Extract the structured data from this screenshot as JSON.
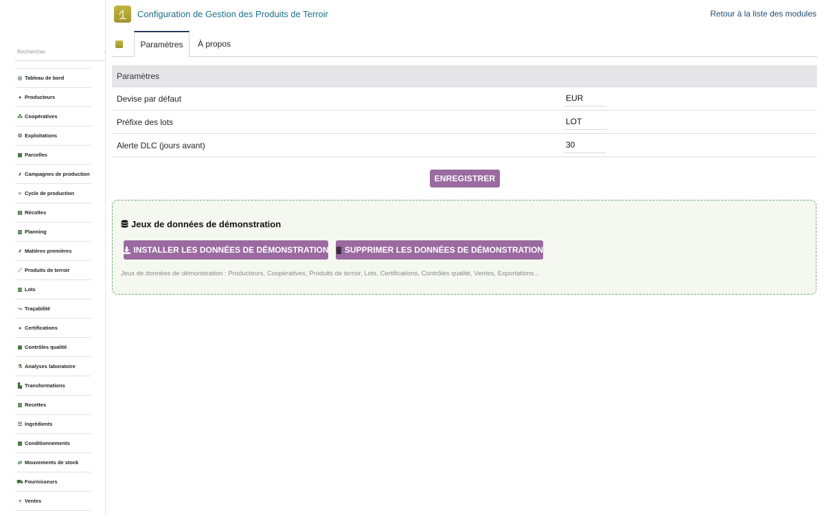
{
  "header": {
    "title": "Configuration de Gestion des Produits de Terroir",
    "back_link": "Retour à la liste des modules"
  },
  "sidebar": {
    "search_placeholder": "Rechercher",
    "items": [
      {
        "label": "Tableau de bord",
        "icon": "dashboard-icon",
        "glyph": "◎"
      },
      {
        "label": "Producteurs",
        "icon": "user-icon",
        "glyph": "●"
      },
      {
        "label": "Coopératives",
        "icon": "users-icon",
        "glyph": "⁂"
      },
      {
        "label": "Exploitations",
        "icon": "tractor-icon",
        "glyph": "⚙"
      },
      {
        "label": "Parcelles",
        "icon": "map-icon",
        "glyph": "▦"
      },
      {
        "label": "Campagnes de production",
        "icon": "leaf-icon",
        "glyph": "⸙"
      },
      {
        "label": "Cycle de production",
        "icon": "list-icon",
        "glyph": "≡"
      },
      {
        "label": "Récoltes",
        "icon": "basket-icon",
        "glyph": "▤"
      },
      {
        "label": "Planning",
        "icon": "calendar-icon",
        "glyph": "▥"
      },
      {
        "label": "Matières premières",
        "icon": "seedling-icon",
        "glyph": "⸙"
      },
      {
        "label": "Produits de terroir",
        "icon": "carrot-icon",
        "glyph": "⟋"
      },
      {
        "label": "Lots",
        "icon": "barcode-icon",
        "glyph": "▥"
      },
      {
        "label": "Traçabilité",
        "icon": "route-icon",
        "glyph": "⤳"
      },
      {
        "label": "Certifications",
        "icon": "certificate-icon",
        "glyph": "●"
      },
      {
        "label": "Contrôles qualité",
        "icon": "clipboard-check-icon",
        "glyph": "▣"
      },
      {
        "label": "Analyses laboratoire",
        "icon": "flask-icon",
        "glyph": "⚗"
      },
      {
        "label": "Transformations",
        "icon": "industry-icon",
        "glyph": "▙"
      },
      {
        "label": "Recettes",
        "icon": "book-icon",
        "glyph": "▥"
      },
      {
        "label": "Ingrédients",
        "icon": "list-ul-icon",
        "glyph": "☰"
      },
      {
        "label": "Conditionnements",
        "icon": "boxes-icon",
        "glyph": "▩"
      },
      {
        "label": "Mouvements de stock",
        "icon": "exchange-icon",
        "glyph": "⇄"
      },
      {
        "label": "Fournisseurs",
        "icon": "truck-icon",
        "glyph": "⛟"
      },
      {
        "label": "Ventes",
        "icon": "hand-holding-icon",
        "glyph": "⥾"
      }
    ]
  },
  "tabs": {
    "settings": "Paramètres",
    "about": "À propos"
  },
  "params": {
    "heading": "Paramètres",
    "rows": [
      {
        "label": "Devise par défaut",
        "value": "EUR"
      },
      {
        "label": "Préfixe des lots",
        "value": "LOT"
      },
      {
        "label": "Alerte DLC (jours avant)",
        "value": "30"
      }
    ],
    "save_label": "ENREGISTRER"
  },
  "demo": {
    "title": "Jeux de données de démonstration",
    "install_label": "INSTALLER LES DONNÉES DE DÉMONSTRATION",
    "delete_label": "SUPPRIMER LES DONNÉES DE DÉMONSTRATION",
    "description": "Jeux de données de démonstration : Producteurs, Coopératives, Produits de terroir, Lots, Certifications, Contrôles qualité, Ventes, Exportations..."
  },
  "colors": {
    "accent_button": "#9a6aa0",
    "title_link": "#1b6f88",
    "tab_active_border": "#25375d",
    "demo_border": "#6aa86b",
    "menu_icon": "#3f6f3a"
  }
}
